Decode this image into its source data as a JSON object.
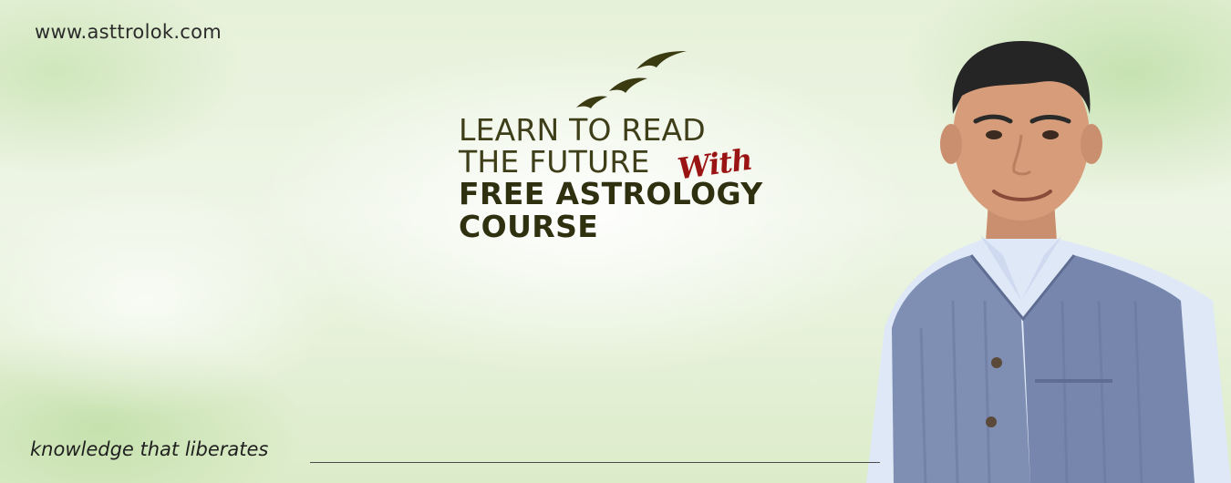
{
  "banner": {
    "site_url": "www.asttrolok.com",
    "headline": {
      "line1": "LEARN TO READ",
      "line2": "THE FUTURE",
      "script_word": "With",
      "line3": "FREE ASTROLOGY",
      "line4": "COURSE"
    },
    "tagline": "knowledge that liberates",
    "colors": {
      "headline_dark": "#2f3010",
      "script_red": "#9a1414",
      "background_green": "#dcecc9",
      "vest_blue": "#7f8fb4",
      "shirt_light_blue": "#dfe8f7"
    },
    "icons": {
      "birds": "flying-birds-icon"
    }
  }
}
